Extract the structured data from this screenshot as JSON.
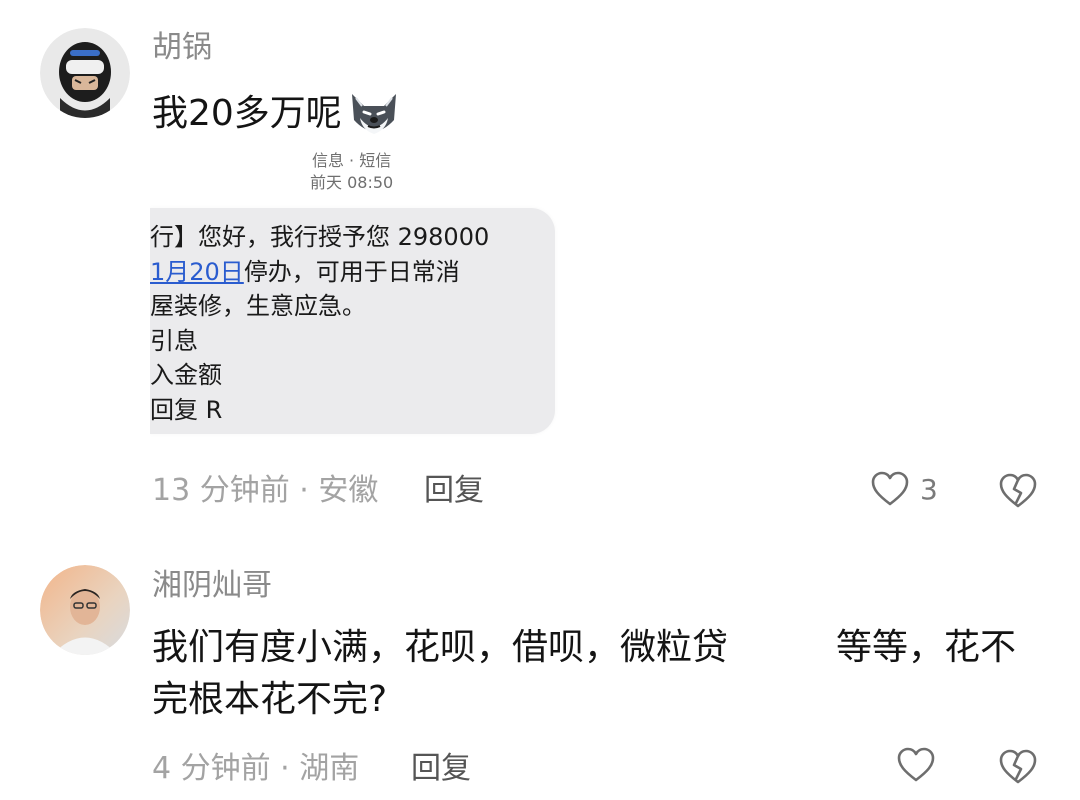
{
  "comments": [
    {
      "username": "胡锅",
      "text": "我20多万呢",
      "emoji": "husky-smirk-icon",
      "sms": {
        "header_source": "信息 · 短信",
        "header_time": "前天 08:50",
        "line1": "行】您好，我行授予您 298000",
        "line2_link": "1月20日",
        "line2_rest": "停办，可用于日常消",
        "line3": "屋装修，生意应急。",
        "line4": "引息",
        "line5": "入金额",
        "line6": "回复 R"
      },
      "meta": "13 分钟前 · 安徽",
      "reply": "回复",
      "likes": "3"
    },
    {
      "username": "湘阴灿哥",
      "text": "我们有度小满，花呗，借呗，微粒贷　　　等等，花不完根本花不完?",
      "meta": "4 分钟前 · 湖南",
      "reply": "回复",
      "likes": ""
    }
  ],
  "colors": {
    "username": "#8a8a8a",
    "meta": "#a3a3a3",
    "link": "#2a5ccf",
    "bubble": "#ebebed"
  }
}
